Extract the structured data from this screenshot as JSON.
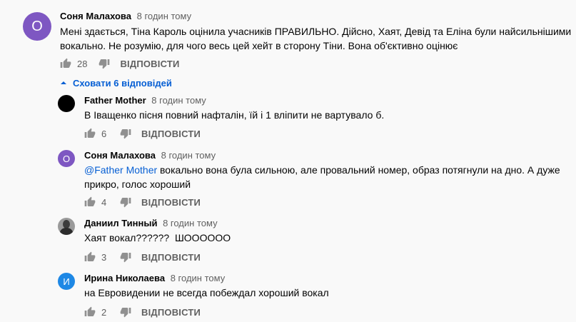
{
  "main_comment": {
    "author": "Соня Малахова",
    "time": "8 годин тому",
    "avatar_letter": "О",
    "avatar_color": "#7e57c2",
    "text_line1": "Мені здається, Тіна Кароль оцінила учасників ПРАВИЛЬНО. Дійсно, Хаят, Девід та Еліна були найсильнішими",
    "text_line2": "вокально. Не розумію, для чого весь цей хейт в сторону Тіни. Вона об'єктивно оцінює",
    "likes": "28",
    "reply_label": "ВІДПОВІСТИ"
  },
  "hide_replies_label": "Сховати 6 відповідей",
  "replies": [
    {
      "author": "Father Mother",
      "time": "8 годин тому",
      "avatar_color": "#000000",
      "text_line1": "В Іващенко пісня повний нафталін, їй і 1 вліпити не вартувало б.",
      "likes": "6",
      "reply_label": "ВІДПОВІСТИ"
    },
    {
      "author": "Соня Малахова",
      "time": "8 годин тому",
      "avatar_letter": "О",
      "avatar_color": "#7e57c2",
      "mention": "@Father Mother",
      "text_line1_rest": " вокально вона була сильною, але провальний номер, образ потягнули на дно. А дуже",
      "text_line2": "прикро, голос хороший",
      "likes": "4",
      "reply_label": "ВІДПОВІСТИ"
    },
    {
      "author": "Даниил Тинный",
      "time": "8 годин тому",
      "text_line1": "Хаят вокал??????  ШОООООО",
      "likes": "3",
      "reply_label": "ВІДПОВІСТИ"
    },
    {
      "author": "Ирина Николаева",
      "time": "8 годин тому",
      "avatar_letter": "И",
      "avatar_color": "#1e88e5",
      "text_line1": "на Евровидении не всегда побеждал хороший вокал",
      "likes": "2",
      "reply_label": "ВІДПОВІСТИ"
    }
  ]
}
